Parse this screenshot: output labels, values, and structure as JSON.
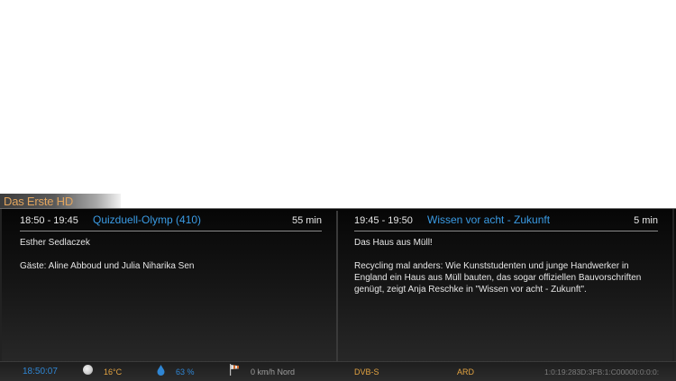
{
  "channel": {
    "name": "Das Erste HD"
  },
  "now": {
    "time": "18:50 -  19:45",
    "title": "Quizduell-Olymp (410)",
    "duration": "55 min",
    "desc_lines": [
      "Esther Sedlaczek",
      "",
      "Gäste: Aline Abboud und Julia Niharika Sen"
    ]
  },
  "next": {
    "time": "19:45 -  19:50",
    "title": "Wissen vor acht - Zukunft",
    "duration": "5 min",
    "desc_lines": [
      "Das Haus aus Müll!",
      "",
      "Recycling mal anders: Wie Kunststudenten und junge Handwerker in",
      "England ein Haus aus Müll bauten, das sogar offiziellen Bauvorschriften",
      "genügt, zeigt Anja Reschke in \"Wissen vor acht - Zukunft\"."
    ]
  },
  "status": {
    "clock": "18:50:07",
    "temperature": "16°C",
    "humidity": "63 %",
    "wind": "0 km/h Nord",
    "tuner": "DVB-S",
    "provider": "ARD",
    "service_ref": "1:0:19:283D:3FB:1:C00000:0:0:0:"
  },
  "colors": {
    "accent": "#3a9be4",
    "orange": "#e3a341"
  },
  "icons": {
    "weather": "moon-icon",
    "humidity": "water-drop-icon",
    "wind": "windsock-icon"
  }
}
